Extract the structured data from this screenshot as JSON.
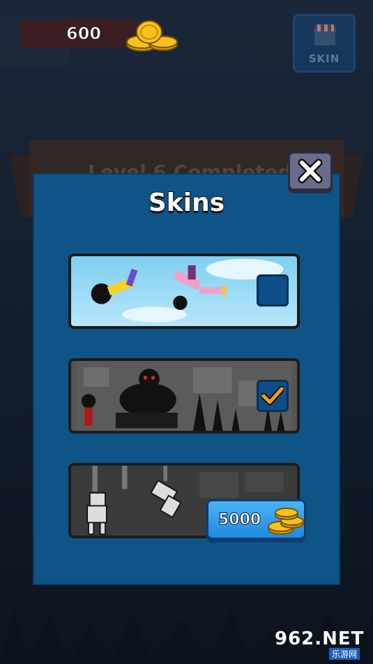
{
  "hud": {
    "coins": "600",
    "skin_button_label": "SKIN"
  },
  "background": {
    "banner_text": "Level 6 Completed"
  },
  "modal": {
    "title": "Skins",
    "close_icon": "close-x-icon"
  },
  "skins": [
    {
      "name": "Cartoon",
      "state": "available"
    },
    {
      "name": "Monster",
      "state": "selected"
    },
    {
      "name": "Robot",
      "state": "locked",
      "price": "5000"
    }
  ],
  "watermark": {
    "brand": "962.NET",
    "sub": "乐游网"
  },
  "colors": {
    "modal_bg": "#0e5486",
    "buy_button": "#2189e0",
    "checkmark": "#f39a1f",
    "coin": "#f7c21b"
  }
}
